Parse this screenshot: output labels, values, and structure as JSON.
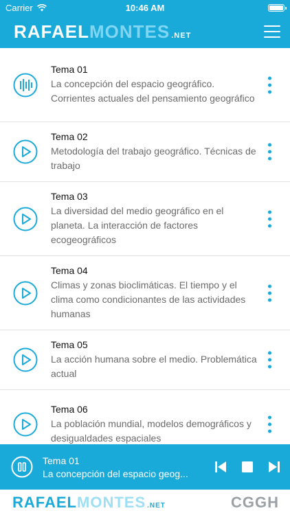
{
  "status": {
    "carrier": "Carrier",
    "time": "10:46 AM"
  },
  "header": {
    "logo_part1": "RAFAEL",
    "logo_part2": "MONTES",
    "logo_suffix": ".NET",
    "menu_icon": "hamburger-icon"
  },
  "topics": [
    {
      "title": "Tema 01",
      "desc": "La concepción del espacio geográfico. Corrientes actuales del pensamiento geográfico",
      "icon": "audio-playing-icon"
    },
    {
      "title": "Tema 02",
      "desc": "Metodología del trabajo geográfico. Técnicas de trabajo",
      "icon": "play-icon"
    },
    {
      "title": "Tema 03",
      "desc": "La diversidad del medio geográfico en el planeta. La interacción de factores ecogeográficos",
      "icon": "play-icon"
    },
    {
      "title": "Tema 04",
      "desc": "Climas y zonas bioclimáticas. El tiempo y el clima como condicionantes de las actividades humanas",
      "icon": "play-icon"
    },
    {
      "title": "Tema 05",
      "desc": "La acción humana sobre el medio. Problemática actual",
      "icon": "play-icon"
    },
    {
      "title": "Tema 06",
      "desc": "La población mundial, modelos demográficos y desigualdades espaciales",
      "icon": "play-icon"
    }
  ],
  "player": {
    "title": "Tema 01",
    "desc": "La concepción del espacio geog...",
    "controls": [
      "previous-icon",
      "stop-icon",
      "next-icon"
    ]
  },
  "footer": {
    "logo_part1": "RAFAEL",
    "logo_part2": "MONTES",
    "logo_suffix": ".NET",
    "badge": "CGGH"
  },
  "colors": {
    "accent": "#1aaad9",
    "text": "#111111",
    "muted": "#6b6b6b"
  }
}
